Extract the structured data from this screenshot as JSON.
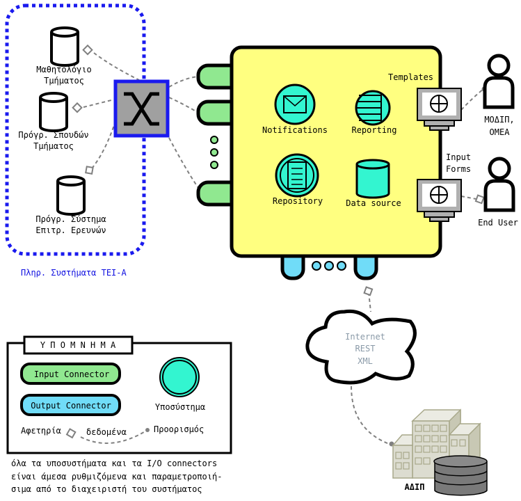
{
  "colors": {
    "group_border": "#1a1aee",
    "system_fill": "#ffff80",
    "input_connector": "#90e890",
    "output_connector": "#70dcf8",
    "subsystem": "#33f5d0",
    "switch_fill": "#a0a0a0",
    "link": "#808080"
  },
  "group": {
    "title": "Πληρ. Συστήματα ΤΕΙ-Α",
    "databases": [
      {
        "line1": "Μαθητολόγιο",
        "line2": "Τμήματος"
      },
      {
        "line1": "Πρόγρ. Σπουδών",
        "line2": "Τμήματος"
      },
      {
        "line1": "Πρόγρ. Σύστημα",
        "line2": "Επιτρ. Ερευνών"
      }
    ]
  },
  "system": {
    "subsystems": {
      "notifications": "Notifications",
      "reporting": "Reporting",
      "repository": "Repository",
      "data_source": "Data source"
    },
    "templates_label": "Templates",
    "input_forms_line1": "Input",
    "input_forms_line2": "Forms"
  },
  "actors": {
    "modip_line1": "ΜΟΔΙΠ,",
    "modip_line2": "ΟΜΕΑ",
    "end_user": "End User"
  },
  "cloud": {
    "line1": "Internet",
    "line2": "REST",
    "line3": "XML"
  },
  "adip": "ΑΔΙΠ",
  "legend": {
    "title": "Υ Π Ο Μ Ν Η Μ Α",
    "input_connector": "Input Connector",
    "output_connector": "Output Connector",
    "subsystem": "Υποσύστημα",
    "origin": "Αφετηρία",
    "data": "δεδομένα",
    "destination": "Προορισμός"
  },
  "footnote": {
    "line1": "όλα τα υποσυστήματα και τα I/O connectors",
    "line2": "είναι άμεσα ρυθμιζόμενα και παραμετροποιή-",
    "line3": "σιμα από το διαχειριστή του συστήματος"
  }
}
